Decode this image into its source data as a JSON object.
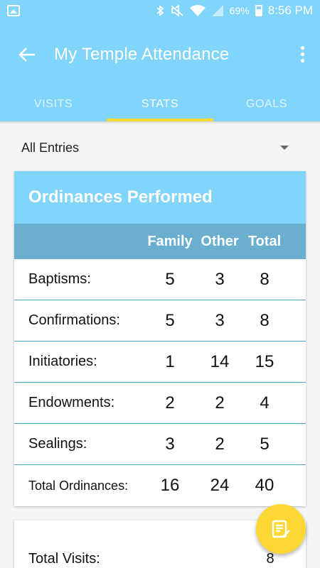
{
  "status_bar": {
    "battery": "69%",
    "time": "8:56 PM"
  },
  "app_bar": {
    "title": "My Temple Attendance"
  },
  "tabs": [
    {
      "label": "VISITS"
    },
    {
      "label": "STATS"
    },
    {
      "label": "GOALS"
    }
  ],
  "filter": {
    "selected": "All Entries"
  },
  "ordinances": {
    "title": "Ordinances Performed",
    "columns": [
      "Family",
      "Other",
      "Total"
    ],
    "rows": [
      {
        "label": "Baptisms:",
        "family": "5",
        "other": "3",
        "total": "8"
      },
      {
        "label": "Confirmations:",
        "family": "5",
        "other": "3",
        "total": "8"
      },
      {
        "label": "Initiatories:",
        "family": "1",
        "other": "14",
        "total": "15"
      },
      {
        "label": "Endowments:",
        "family": "2",
        "other": "2",
        "total": "4"
      },
      {
        "label": "Sealings:",
        "family": "3",
        "other": "2",
        "total": "5"
      },
      {
        "label": "Total Ordinances:",
        "family": "16",
        "other": "24",
        "total": "40"
      }
    ]
  },
  "visits": {
    "label": "Total Visits:",
    "value": "8"
  },
  "colors": {
    "primary": "#81d4fa",
    "header_row": "#6aaed0",
    "accent": "#fdd835",
    "divider": "#4aa3c8"
  },
  "icons": {
    "back": "arrow-back-icon",
    "menu": "more-vert-icon",
    "fab": "edit-note-icon"
  }
}
